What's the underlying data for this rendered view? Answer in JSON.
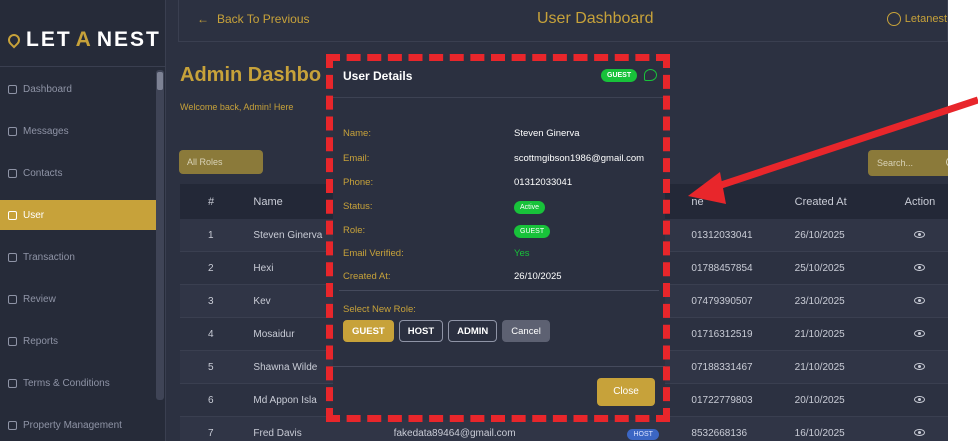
{
  "sidebar": {
    "logo_prefix": "LET",
    "logo_accent": "A",
    "logo_suffix": "NEST",
    "items": [
      {
        "label": "Dashboard"
      },
      {
        "label": "Messages"
      },
      {
        "label": "Contacts"
      },
      {
        "label": "User"
      },
      {
        "label": "Transaction"
      },
      {
        "label": "Review"
      },
      {
        "label": "Reports"
      },
      {
        "label": "Terms & Conditions"
      },
      {
        "label": "Property Management"
      }
    ]
  },
  "topbar": {
    "back_label": "Back To Previous",
    "title": "User Dashboard",
    "user_name": "Letanest"
  },
  "main": {
    "title": "Admin Dashbo",
    "subtitle": "Welcome back, Admin! Here",
    "filter_label": "All Roles",
    "search_placeholder": "Search..."
  },
  "table": {
    "headers": [
      "#",
      "Name",
      "",
      "",
      "ne",
      "Created At",
      "Action"
    ],
    "rows": [
      {
        "no": "1",
        "name": "Steven Ginerva",
        "email": "",
        "role": "",
        "phone": "01312033041",
        "created": "26/10/2025"
      },
      {
        "no": "2",
        "name": "Hexi",
        "email": "",
        "role": "",
        "phone": "01788457854",
        "created": "25/10/2025"
      },
      {
        "no": "3",
        "name": "Kev",
        "email": "",
        "role": "",
        "phone": "07479390507",
        "created": "23/10/2025"
      },
      {
        "no": "4",
        "name": "Mosaidur",
        "email": "",
        "role": "",
        "phone": "01716312519",
        "created": "21/10/2025"
      },
      {
        "no": "5",
        "name": "Shawna Wilde",
        "email": "",
        "role": "",
        "phone": "07188331467",
        "created": "21/10/2025"
      },
      {
        "no": "6",
        "name": "Md Appon Isla",
        "email": "",
        "role": "",
        "phone": "01722779803",
        "created": "20/10/2025"
      },
      {
        "no": "7",
        "name": "Fred Davis",
        "email": "fakedata89464@gmail.com",
        "role": "HOST",
        "phone": "8532668136",
        "created": "16/10/2025"
      }
    ]
  },
  "modal": {
    "title": "User Details",
    "badge": "GUEST",
    "fields": {
      "name_label": "Name:",
      "name_value": "Steven Ginerva",
      "email_label": "Email:",
      "email_value": "scottmgibson1986@gmail.com",
      "phone_label": "Phone:",
      "phone_value": "01312033041",
      "status_label": "Status:",
      "status_value": "Active",
      "role_label": "Role:",
      "role_value": "GUEST",
      "verified_label": "Email Verified:",
      "verified_value": "Yes",
      "created_label": "Created At:",
      "created_value": "26/10/2025"
    },
    "select_role_label": "Select New Role:",
    "role_buttons": {
      "guest": "GUEST",
      "host": "HOST",
      "admin": "ADMIN",
      "cancel": "Cancel"
    },
    "close_label": "Close"
  },
  "colors": {
    "accent": "#c7a23a",
    "panel": "#2c3141",
    "success": "#18c23a",
    "annotation": "#e8262b"
  }
}
